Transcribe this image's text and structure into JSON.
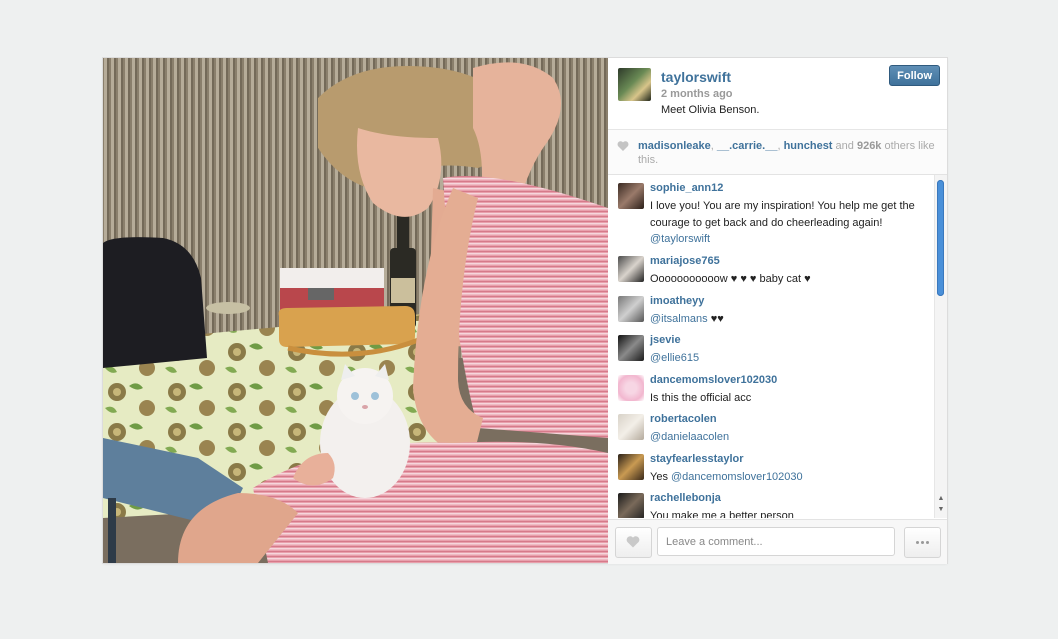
{
  "post": {
    "username": "taylorswift",
    "time_ago": "2 months ago",
    "caption": "Meet Olivia Benson.",
    "follow_label": "Follow"
  },
  "likes": {
    "users": [
      "madisonleake",
      "__.carrie.__",
      "hunchest"
    ],
    "sep1": ", ",
    "sep2": ", ",
    "and_text": " and ",
    "count": "926k",
    "suffix": " others like this."
  },
  "comments": [
    {
      "user": "sophie_ann12",
      "text": "I love you! You are my inspiration! You help me get the courage to get back and do cheerleading again!",
      "mention": "@taylorswift"
    },
    {
      "user": "mariajose765",
      "text": "Ooooooooooow ♥ ♥ ♥ baby cat ♥",
      "mention": ""
    },
    {
      "user": "imoatheyy",
      "text": " ♥♥",
      "mention": "@itsalmans"
    },
    {
      "user": "jsevie",
      "text": "",
      "mention": "@ellie615"
    },
    {
      "user": "dancemomslover102030",
      "text": "Is this the official acc",
      "mention": ""
    },
    {
      "user": "robertacolen",
      "text": "",
      "mention": "@danielaacolen"
    },
    {
      "user": "stayfearlesstaylor",
      "text": "Yes ",
      "mention": "@dancemomslover102030"
    },
    {
      "user": "rachellebonja",
      "text": "You make me a better person",
      "mention": ""
    }
  ],
  "footer": {
    "comment_placeholder": "Leave a comment..."
  },
  "icons": {
    "like": "heart-icon",
    "more": "ellipsis-icon",
    "scroll_up": "scroll-up-arrow-icon",
    "scroll_down": "scroll-down-arrow-icon"
  },
  "colors": {
    "link_blue": "#3f729b",
    "follow_button": "#3f729b",
    "scroll_thumb": "#4a90d9"
  }
}
